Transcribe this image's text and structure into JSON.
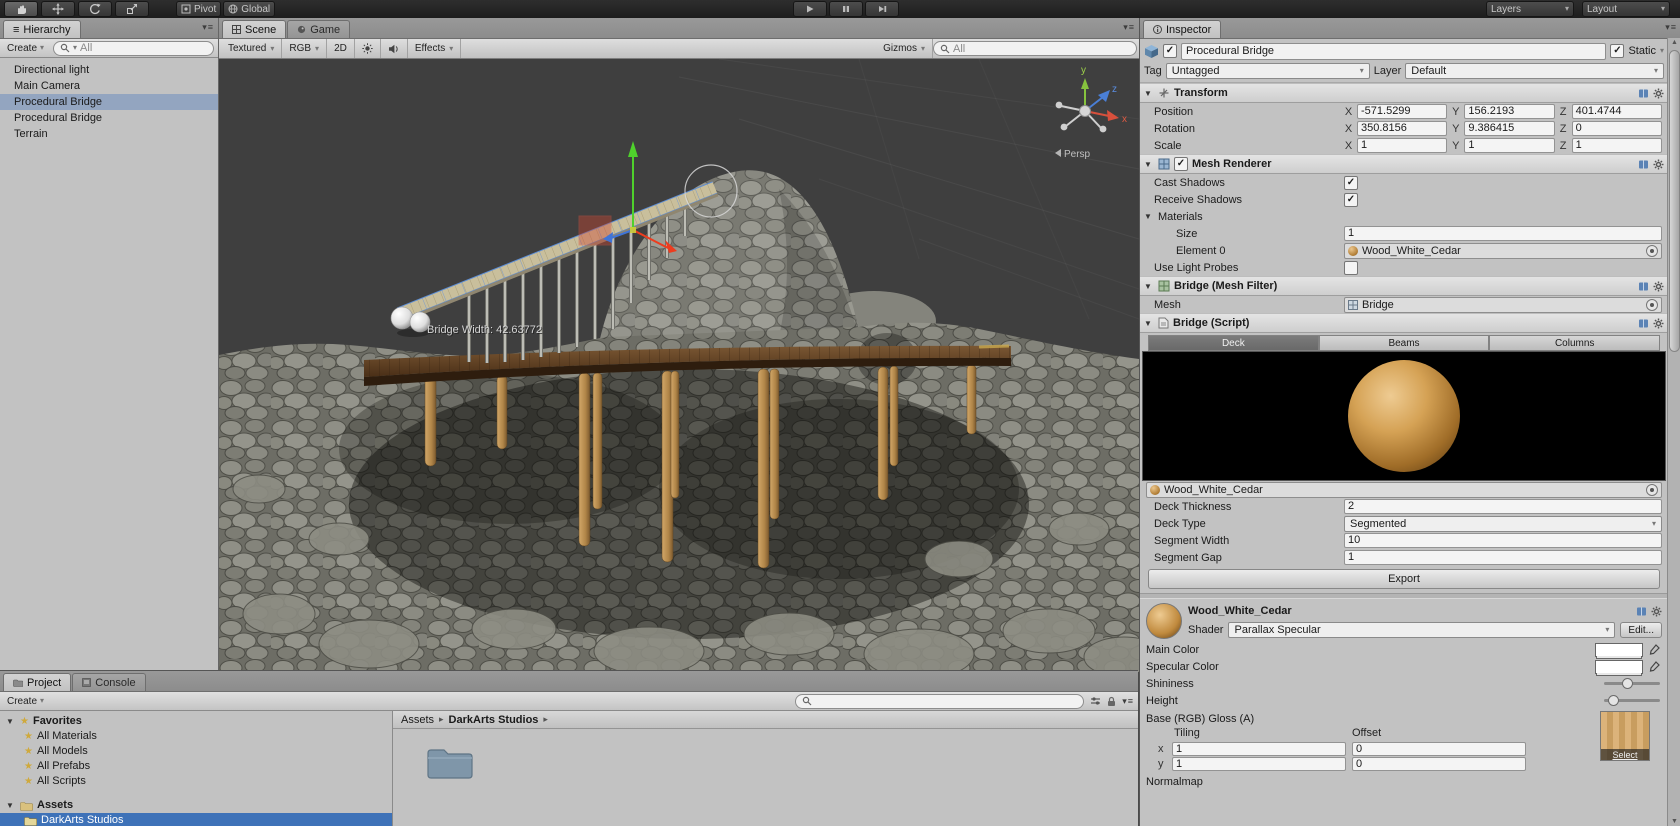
{
  "topbar": {
    "pivot": "Pivot",
    "global": "Global",
    "layers": "Layers",
    "layout": "Layout"
  },
  "hierarchy": {
    "tab": "Hierarchy",
    "create": "Create",
    "search": "All",
    "items": [
      "Directional light",
      "Main Camera",
      "Procedural Bridge",
      "Procedural Bridge",
      "Terrain"
    ]
  },
  "scene": {
    "tab_scene": "Scene",
    "tab_game": "Game",
    "textured": "Textured",
    "rgb": "RGB",
    "two_d": "2D",
    "effects": "Effects",
    "gizmos": "Gizmos",
    "search": "All",
    "overlay": "Bridge Width: 42.63772",
    "persp": "Persp",
    "axis_x": "x",
    "axis_y": "y",
    "axis_z": "z"
  },
  "inspector": {
    "tab": "Inspector",
    "name": "Procedural Bridge",
    "static_label": "Static",
    "tag_label": "Tag",
    "tag": "Untagged",
    "layer_label": "Layer",
    "layer": "Default",
    "checks": {
      "active": "✓",
      "static": "✓",
      "renderer": "✓",
      "cast": "✓",
      "receive": "✓",
      "probes": ""
    },
    "transform": {
      "title": "Transform",
      "x": "X",
      "y": "Y",
      "z": "Z",
      "rows": [
        {
          "label": "Position",
          "x": "-571.5299",
          "y": "156.2193",
          "z": "401.4744"
        },
        {
          "label": "Rotation",
          "x": "350.8156",
          "y": "9.386415",
          "z": "0"
        },
        {
          "label": "Scale",
          "x": "1",
          "y": "1",
          "z": "1"
        }
      ]
    },
    "renderer": {
      "title": "Mesh Renderer",
      "cast": "Cast Shadows",
      "receive": "Receive Shadows",
      "materials": "Materials",
      "size": "Size",
      "size_value": "1",
      "element": "Element 0",
      "element_value": "Wood_White_Cedar",
      "probes": "Use Light Probes"
    },
    "filter": {
      "title": "Bridge (Mesh Filter)",
      "mesh": "Mesh",
      "mesh_value": "Bridge"
    },
    "script": {
      "title": "Bridge (Script)",
      "tab_deck": "Deck",
      "tab_beams": "Beams",
      "tab_columns": "Columns",
      "material": "Wood_White_Cedar",
      "f1_label": "Deck Thickness",
      "f1": "2",
      "f2_label": "Deck Type",
      "f2": "Segmented",
      "f3_label": "Segment Width",
      "f3": "10",
      "f4_label": "Segment Gap",
      "f4": "1",
      "export": "Export"
    },
    "material": {
      "name": "Wood_White_Cedar",
      "shader_label": "Shader",
      "shader": "Parallax Specular",
      "edit": "Edit...",
      "main_color": "Main Color",
      "specular_color": "Specular Color",
      "shininess": "Shininess",
      "height": "Height",
      "base": "Base (RGB) Gloss (A)",
      "tiling": "Tiling",
      "offset": "Offset",
      "xl": "x",
      "yl": "y",
      "tx": "1",
      "ty": "1",
      "ox": "0",
      "oy": "0",
      "select": "Select",
      "normalmap": "Normalmap"
    }
  },
  "project": {
    "tab_project": "Project",
    "tab_console": "Console",
    "create": "Create",
    "favorites": "Favorites",
    "fav_items": [
      "All Materials",
      "All Models",
      "All Prefabs",
      "All Scripts"
    ],
    "assets": "Assets",
    "child": "DarkArts Studios",
    "crumb_root": "Assets",
    "crumb_current": "DarkArts Studios"
  }
}
